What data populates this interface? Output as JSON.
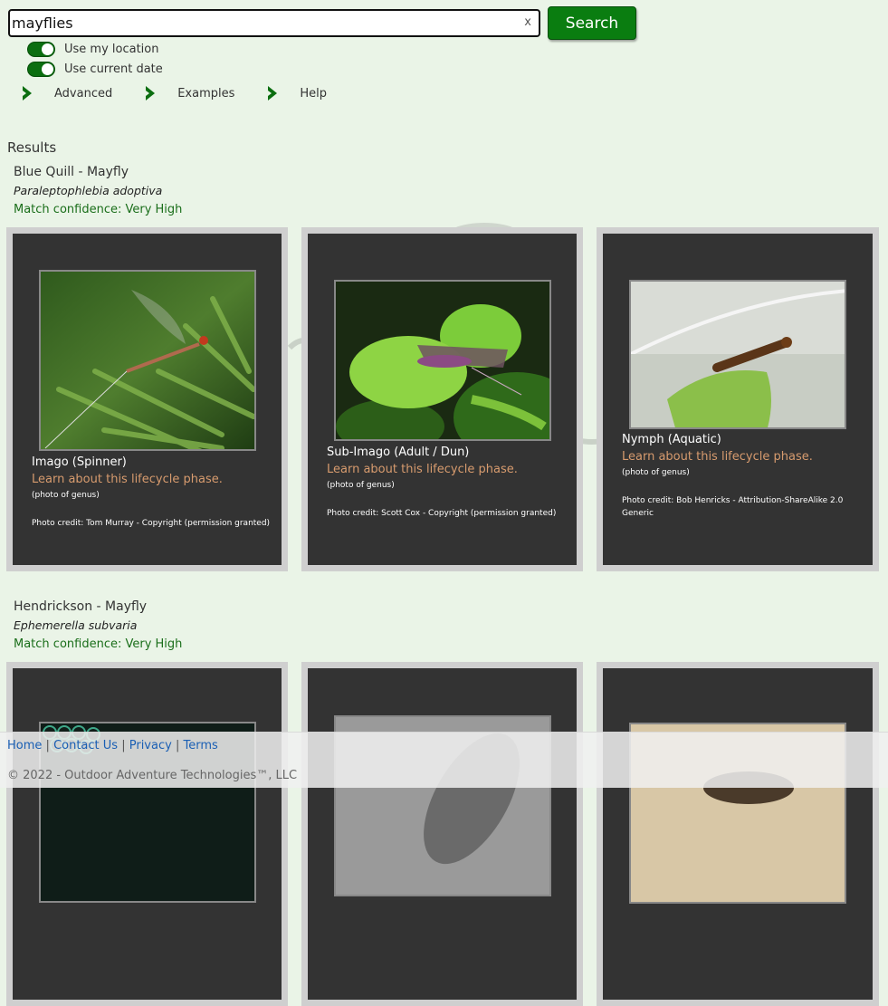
{
  "search": {
    "value": "mayflies",
    "clear_label": "x",
    "button_label": "Search"
  },
  "options": {
    "use_location": {
      "label": "Use my location",
      "on": true
    },
    "use_date": {
      "label": "Use current date",
      "on": true
    }
  },
  "nav": [
    {
      "label": "Advanced"
    },
    {
      "label": "Examples"
    },
    {
      "label": "Help"
    }
  ],
  "results_label": "Results",
  "results": [
    {
      "common_name": "Blue Quill - Mayfly",
      "scientific_name": "Paraleptophlebia adoptiva",
      "confidence": "Match confidence: Very High",
      "cards": [
        {
          "phase": "Imago (Spinner)",
          "learn": "Learn about this lifecycle phase.",
          "note": "(photo of genus)",
          "credit": "Photo credit: Tom Murray - Copyright (permission granted)",
          "image": "mayfly-spinner-photo"
        },
        {
          "phase": "Sub-Imago (Adult / Dun)",
          "learn": "Learn about this lifecycle phase.",
          "note": "(photo of genus)",
          "credit": "Photo credit: Scott Cox - Copyright (permission granted)",
          "image": "mayfly-dun-photo"
        },
        {
          "phase": "Nymph (Aquatic)",
          "learn": "Learn about this lifecycle phase.",
          "note": "(photo of genus)",
          "credit": "Photo credit: Bob Henricks - Attribution-ShareAlike 2.0 Generic",
          "image": "mayfly-nymph-photo"
        }
      ]
    },
    {
      "common_name": "Hendrickson - Mayfly",
      "scientific_name": "Ephemerella subvaria",
      "confidence": "Match confidence: Very High"
    }
  ],
  "footer": {
    "links": [
      "Home",
      "Contact Us",
      "Privacy",
      "Terms"
    ],
    "separator": "|",
    "copyright": "© 2022 - Outdoor Adventure Technologies™, LLC"
  },
  "colors": {
    "background": "#eaf4e7",
    "accent_green": "#0a7d10",
    "card_bg": "#333333",
    "card_border": "#cfcfcf",
    "learn_link": "#d79b6e",
    "confidence_text": "#1a6e1a",
    "footer_link": "#1a5fb4"
  }
}
